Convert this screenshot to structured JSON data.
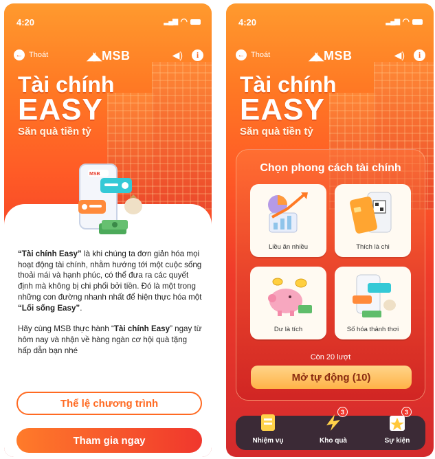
{
  "screen1": {
    "status_time": "4:20",
    "back_label": "Thoát",
    "logo_text": "MSB",
    "headline_1": "Tài chính",
    "headline_2": "EASY",
    "headline_3": "Săn quà tiền tỷ",
    "illustration_logo": "MSB",
    "desc_p1_bold1": "“Tài chính Easy”",
    "desc_p1_text1": " là khi chúng ta đơn giản hóa mọi hoạt động tài chính, nhằm hướng tới một cuộc sống thoải mái và hạnh phúc, có thể đưa ra các quyết định mà không bị chi phối bởi tiền. Đó là một trong những con đường nhanh nhất để hiện thực hóa một ",
    "desc_p1_bold2": "“Lối sống Easy”",
    "desc_p1_text2": ".",
    "desc_p2_text1": "Hãy cùng MSB thực hành “",
    "desc_p2_bold": "Tài chính Easy",
    "desc_p2_text2": "” ngay từ hôm nay và nhận về hàng ngàn cơ hội quà tặng hấp dẫn bạn nhé",
    "rules_button": "Thể lệ chương trình",
    "join_button": "Tham gia ngay"
  },
  "screen2": {
    "status_time": "4:20",
    "back_label": "Thoát",
    "logo_text": "MSB",
    "headline_1": "Tài chính",
    "headline_2": "EASY",
    "headline_3": "Săn quà tiền tỷ",
    "panel_title": "Chọn phong cách tài chính",
    "options": [
      {
        "label": "Liều ăn nhiều"
      },
      {
        "label": "Thích là chi"
      },
      {
        "label": "Dư là tích"
      },
      {
        "label": "Số hóa thảnh thơi"
      }
    ],
    "remaining": "Còn 20 lượt",
    "auto_button": "Mở tự động (10)",
    "nav": [
      {
        "label": "Nhiệm vụ",
        "badge": ""
      },
      {
        "label": "Kho quà",
        "badge": "3"
      },
      {
        "label": "Sự kiện",
        "badge": "3"
      }
    ]
  },
  "colors": {
    "accent": "#ff6a22",
    "accent_red": "#f0372d",
    "nav_bg": "#3b2a36"
  },
  "icons": [
    "back-arrow-icon",
    "msb-logo-icon",
    "sound-icon",
    "info-icon",
    "signal-icon",
    "wifi-icon",
    "battery-icon"
  ]
}
